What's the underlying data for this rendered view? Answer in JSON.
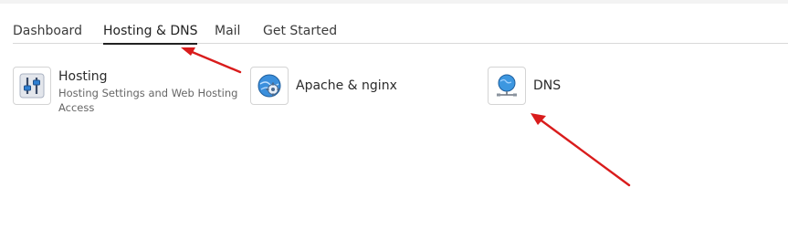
{
  "tabs": [
    {
      "label": "Dashboard",
      "active": false
    },
    {
      "label": "Hosting & DNS",
      "active": true
    },
    {
      "label": "Mail",
      "active": false
    },
    {
      "label": "Get Started",
      "active": false
    }
  ],
  "tiles": {
    "hosting": {
      "title": "Hosting",
      "description": "Hosting Settings and Web Hosting Access",
      "icon": "hosting-settings-icon"
    },
    "apache": {
      "title": "Apache & nginx",
      "icon": "apache-nginx-gear-icon"
    },
    "dns": {
      "title": "DNS",
      "icon": "dns-globe-icon"
    }
  },
  "colors": {
    "annotation_arrow": "#d91c1c",
    "active_tab_underline": "#222222"
  }
}
